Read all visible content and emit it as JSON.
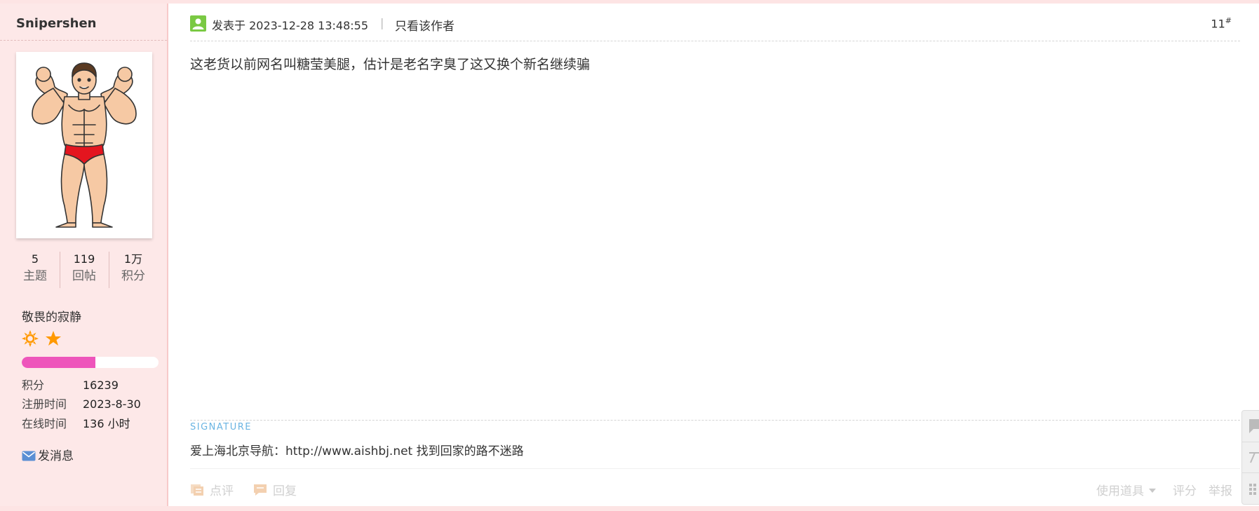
{
  "author": {
    "username": "Snipershen",
    "stats": [
      {
        "value": "5",
        "label": "主题"
      },
      {
        "value": "119",
        "label": "回帖"
      },
      {
        "value": "1万",
        "label": "积分"
      }
    ],
    "group": "敬畏的寂静",
    "rank_icons": [
      "sun-icon",
      "star-icon"
    ],
    "progress_fraction": 0.54,
    "info": [
      {
        "key": "积分",
        "value": "16239"
      },
      {
        "key": "注册时间",
        "value": "2023-8-30"
      },
      {
        "key": "在线时间",
        "value": "136 小时"
      }
    ],
    "send_message_label": "发消息"
  },
  "post": {
    "posted_at": "发表于 2023-12-28 13:48:55",
    "separator": "|",
    "only_author_label": "只看该作者",
    "floor_number": "11",
    "floor_suffix": "#",
    "content": "这老货以前网名叫糖莹美腿，估计是老名字臭了这又换个新名继续骗",
    "signature_label": "SIGNATURE",
    "signature_text": "爱上海北京导航：http://www.aishbj.net 找到回家的路不迷路"
  },
  "actions": {
    "comment_label": "点评",
    "reply_label": "回复",
    "use_tool_label": "使用道具",
    "rate_label": "评分",
    "report_label": "举报"
  },
  "colors": {
    "sidebar_bg": "#fde8e8",
    "progress_fill": "#ee55bb",
    "signature_label": "#6ab4e2",
    "rank_icon": "#ff9900",
    "user_icon": "#7ac943"
  }
}
